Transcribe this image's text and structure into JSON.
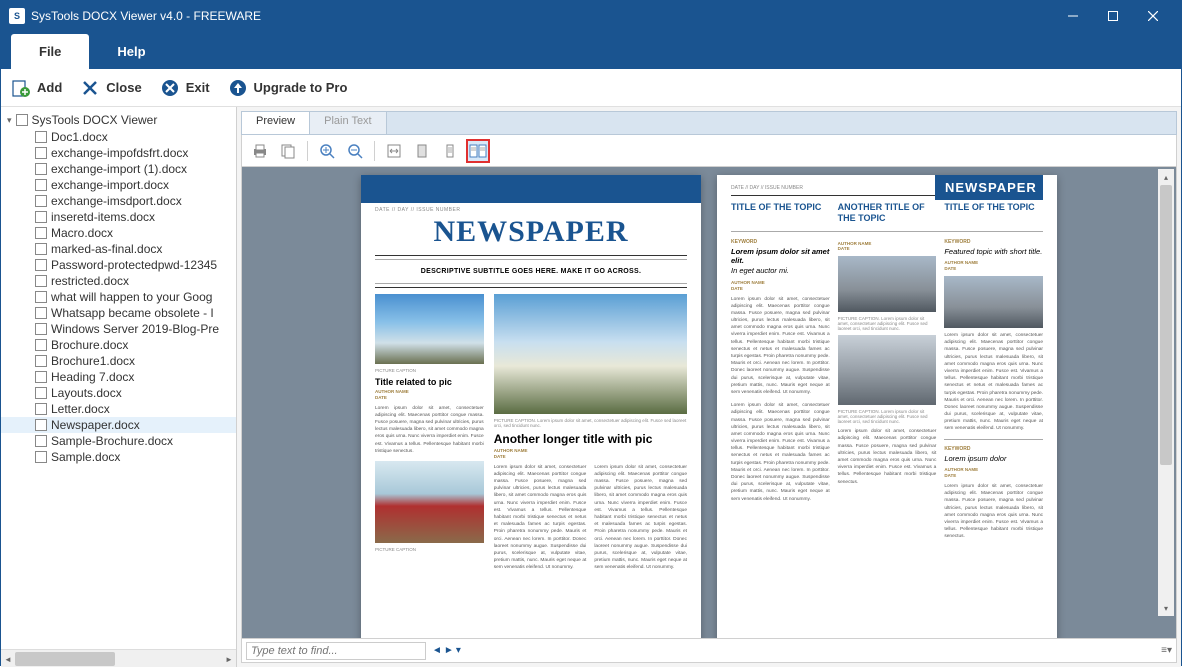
{
  "window": {
    "title": "SysTools DOCX Viewer v4.0 - FREEWARE",
    "icon_letter": "S"
  },
  "menus": {
    "file": "File",
    "help": "Help"
  },
  "toolbar": {
    "add": "Add",
    "close": "Close",
    "exit": "Exit",
    "upgrade": "Upgrade to Pro"
  },
  "tree": {
    "root": "SysTools DOCX Viewer",
    "items": [
      "Doc1.docx",
      "exchange-impofdsfrt.docx",
      "exchange-import (1).docx",
      "exchange-import.docx",
      "exchange-imsdport.docx",
      "inseretd-items.docx",
      "Macro.docx",
      "marked-as-final.docx",
      "Password-protectedpwd-12345",
      "restricted.docx",
      "what will happen to your Goog",
      "Whatsapp became obsolete - I",
      "Windows Server 2019-Blog-Pre",
      "Brochure.docx",
      "Brochure1.docx",
      "Heading 7.docx",
      "Layouts.docx",
      "Letter.docx",
      "Newspaper.docx",
      "Sample-Brochure.docx",
      "Sample.docx"
    ],
    "selected_index": 18
  },
  "view_tabs": {
    "preview": "Preview",
    "plain_text": "Plain Text"
  },
  "find": {
    "placeholder": "Type text to find..."
  },
  "doc": {
    "dateline": "DATE  //  DAY  //  ISSUE NUMBER",
    "masthead": "NEWSPAPER",
    "subtitle": "DESCRIPTIVE SUBTITLE GOES HERE.  MAKE IT GO ACROSS.",
    "article1_title": "Title related to pic",
    "byline": "AUTHOR NAME\nDATE",
    "caption": "PICTURE CAPTION. Lorem ipsum dolor sit amet, consectetuer adipiscing elit. Fusce sed laoreet orci, sed tincidunt nunc.",
    "article2_title": "Another longer title with pic",
    "lipsum_short": "Lorem ipsum dolor sit amet, consectetuer adipiscing elit. Maecenas porttitor congue massa. Fusce posuere, magna sed pulvinar ultricies, purus lectus malesuada libero, sit amet commodo magna eros quis urna. Nunc viverra imperdiet enim. Fusce est. Vivamus a tellus. Pellentesque habitant morbi tristique senectus.",
    "lipsum_long": "Lorem ipsum dolor sit amet, consectetuer adipiscing elit. Maecenas porttitor congue massa. Fusce posuere, magna sed pulvinar ultricies, purus lectus malesuada libero, sit amet commodo magna eros quis urna. Nunc viverra imperdiet enim. Fusce est. Vivamus a tellus. Pellentesque habitant morbi tristique senectus et netus et malesuada fames ac turpis egestas. Proin pharetra nonummy pede. Mauris et orci. Aenean nec lorem. In porttitor. Donec laoreet nonummy augue. Suspendisse dui purus, scelerisque at, vulputate vitae, pretium mattis, nunc. Mauris eget neque at sem venenatis eleifend. Ut nonummy.",
    "page2": {
      "topic1": "TITLE OF THE TOPIC",
      "topic2": "ANOTHER TITLE OF THE TOPIC",
      "topic3": "TITLE OF THE TOPIC",
      "keyword": "KEYWORD",
      "lead1": "Lorem ipsum dolor sit amet elit.",
      "lead1b": "In eget auctor mi.",
      "lead3": "Featured topic with short title.",
      "lead4": "Lorem ipsum dolor"
    }
  }
}
